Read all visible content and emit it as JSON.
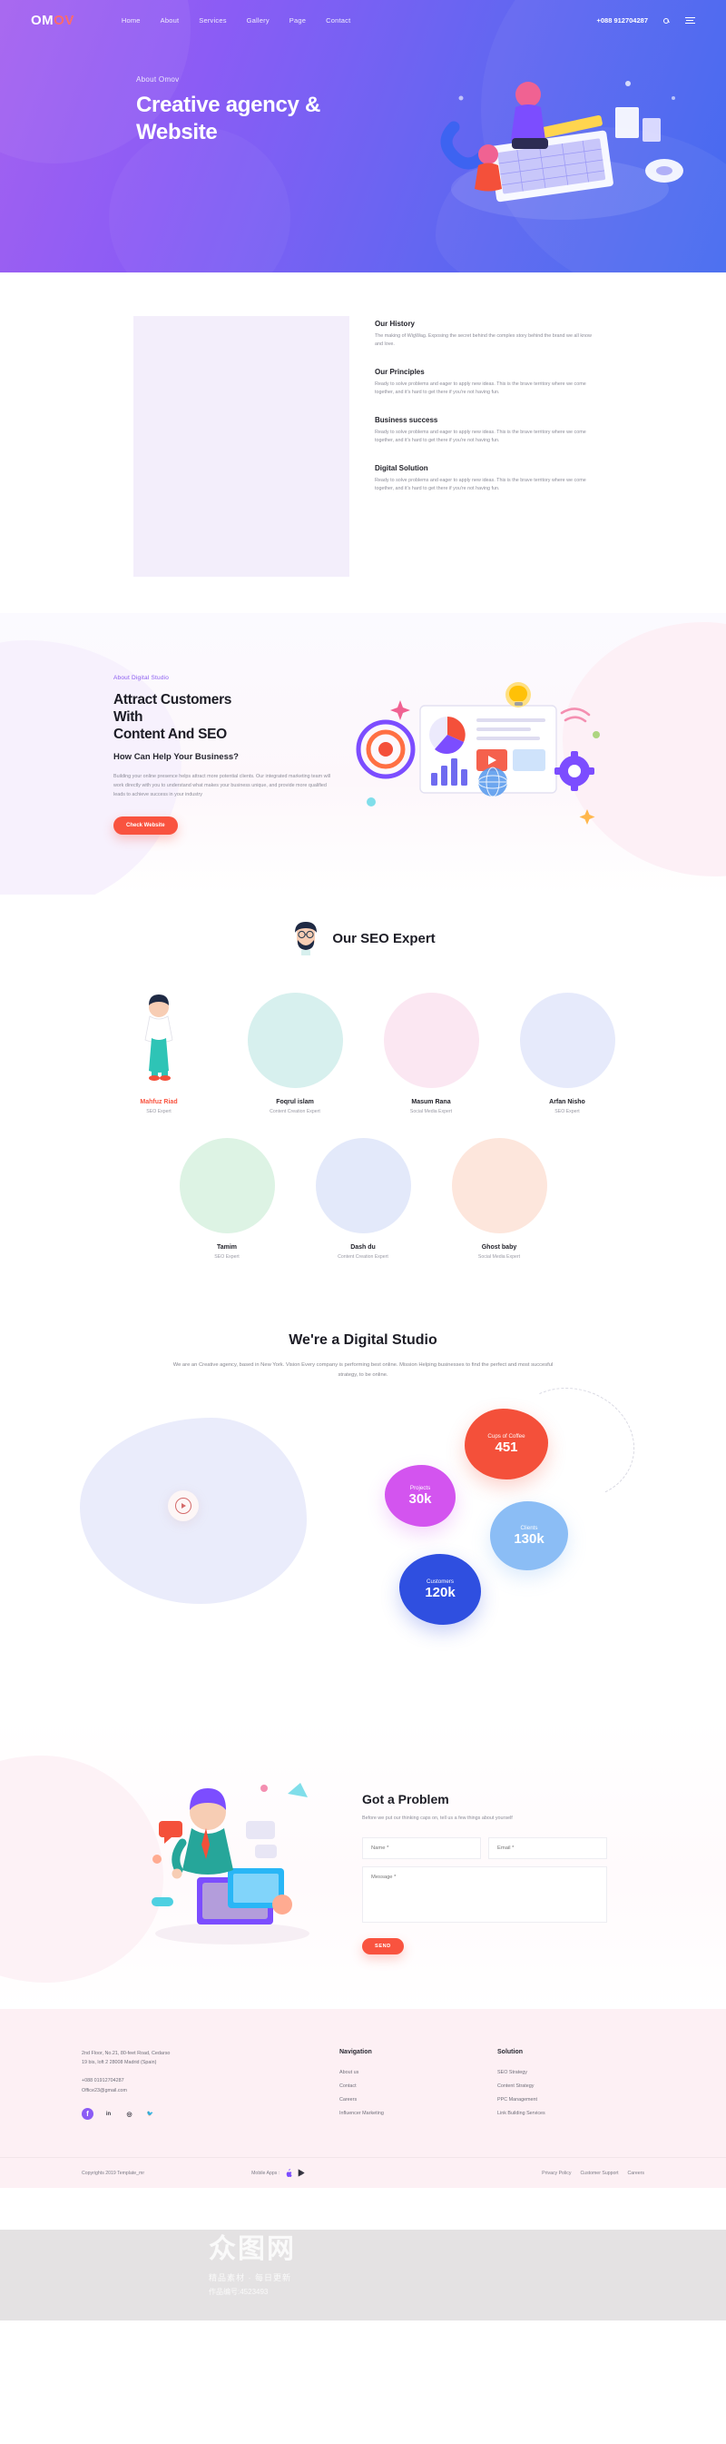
{
  "header": {
    "logo_om": "OM",
    "logo_ov": "OV",
    "nav": [
      {
        "label": "Home"
      },
      {
        "label": "About"
      },
      {
        "label": "Services"
      },
      {
        "label": "Gallery"
      },
      {
        "label": "Page"
      },
      {
        "label": "Contact"
      }
    ],
    "phone": "+088 912704287",
    "search_icon": "search-icon",
    "menu_icon": "hamburger-menu-icon"
  },
  "hero": {
    "kicker": "About Omov",
    "title_line1": "Creative agency &",
    "title_line2": "Website"
  },
  "history": {
    "items": [
      {
        "title": "Our History",
        "body": "The making of WigWag. Exposing the secret behind the complex story behind the brand we all know and love."
      },
      {
        "title": "Our Principles",
        "body": "Ready to solve problems and eager to apply new ideas. This is the brave territory where we come together, and it's hard to get there if you're not having fun."
      },
      {
        "title": "Business success",
        "body": "Ready to solve problems and eager to apply new ideas. This is the brave territory where we come together, and it's hard to get there if you're not having fun."
      },
      {
        "title": "Digital Solution",
        "body": "Ready to solve problems and eager to apply new ideas. This is the brave territory where we come together, and it's hard to get there if you're not having fun."
      }
    ]
  },
  "attract": {
    "kicker": "About Digital Studio",
    "heading_line1": "Attract Customers",
    "heading_line2": "With",
    "heading_line3": "Content And SEO",
    "subheading": "How Can Help Your Business?",
    "body": "Building your online presence helps attract more potential clients. Our integrated marketing team will work directly with you to understand what makes your business unique, and provide more qualified leads to achieve success in your industry",
    "cta_label": "Check Website"
  },
  "team": {
    "title": "Our SEO Expert",
    "members": [
      {
        "name": "Mahfuz Riad",
        "role": "SEO Expert",
        "color": "#d7f0ee",
        "highlight": true
      },
      {
        "name": "Foqrul islam",
        "role": "Content Creation Expert",
        "color": "#fbe7f2",
        "highlight": false
      },
      {
        "name": "Masum Rana",
        "role": "Social Media Expert",
        "color": "#fde6dd",
        "highlight": false
      },
      {
        "name": "Arfan Nisho",
        "role": "SEO Expert",
        "color": "#e6eafb",
        "highlight": false
      },
      {
        "name": "Tamim",
        "role": "SEO Expert",
        "color": "#ddf3e4",
        "highlight": false
      },
      {
        "name": "Dash du",
        "role": "Content Creation Expert",
        "color": "#e3e9fa",
        "highlight": false
      },
      {
        "name": "Ghost baby",
        "role": "Social Media Expert",
        "color": "#fde6dc",
        "highlight": false
      }
    ]
  },
  "studio": {
    "title": "We're a Digital Studio",
    "lead": "We are an Creative agency, based in New York. Vision Every company is performing best online. Mission Helping businesses to find the perfect and most succesful strategy, to be online.",
    "play_icon": "play-button-icon"
  },
  "chart_data": {
    "type": "bar",
    "title": "Company Statistics",
    "categories": [
      "Cups of Coffee",
      "Projects",
      "Clients",
      "Customers"
    ],
    "values": [
      451,
      30000,
      130000,
      120000
    ],
    "display_values": [
      "451",
      "30k",
      "130k",
      "120k"
    ],
    "colors": [
      "#f4503a",
      "#d354ef",
      "#8bbdf5",
      "#2f4fe0"
    ],
    "xlabel": "",
    "ylabel": "",
    "legend": "none"
  },
  "contact": {
    "title": "Got a Problem",
    "subtitle": "Before we put our thinking caps on, tell us a few things about yourself",
    "name_placeholder": "Name *",
    "email_placeholder": "Email *",
    "message_placeholder": "Message *",
    "send_label": "SEND"
  },
  "footer": {
    "address_line1": "2nd Floor, No.21, 80-feet Road, Cedarso",
    "address_line2": "19 bis, loft 2 28008 Madrid (Spain)",
    "phone": "+088 01912704287",
    "email": "Office23@gmail.com",
    "socials": [
      {
        "name": "facebook-icon",
        "glyph": "f"
      },
      {
        "name": "linkedin-icon",
        "glyph": "in"
      },
      {
        "name": "instagram-icon",
        "glyph": "◎"
      },
      {
        "name": "twitter-icon",
        "glyph": "🐦"
      }
    ],
    "columns": [
      {
        "title": "Navigation",
        "links": [
          "About us",
          "Contact",
          "Careers",
          "Influencer Marketing"
        ]
      },
      {
        "title": "Solution",
        "links": [
          "SEO Strategy",
          "Content Strategy",
          "PPC Management",
          "Link Building Services"
        ]
      }
    ],
    "copyright": "Copyrights 2019 Template_mr",
    "mobile_apps_label": "Mobile Apps :",
    "app_icons": [
      "apple-store-icon",
      "google-play-icon"
    ],
    "bottom_links": [
      "Privacy Policy",
      "Customer Support",
      "Careers"
    ]
  },
  "watermark": {
    "cn_main": "众图网",
    "cn_sub": "精品素材 · 每日更新",
    "code": "作品编号:4523493"
  }
}
